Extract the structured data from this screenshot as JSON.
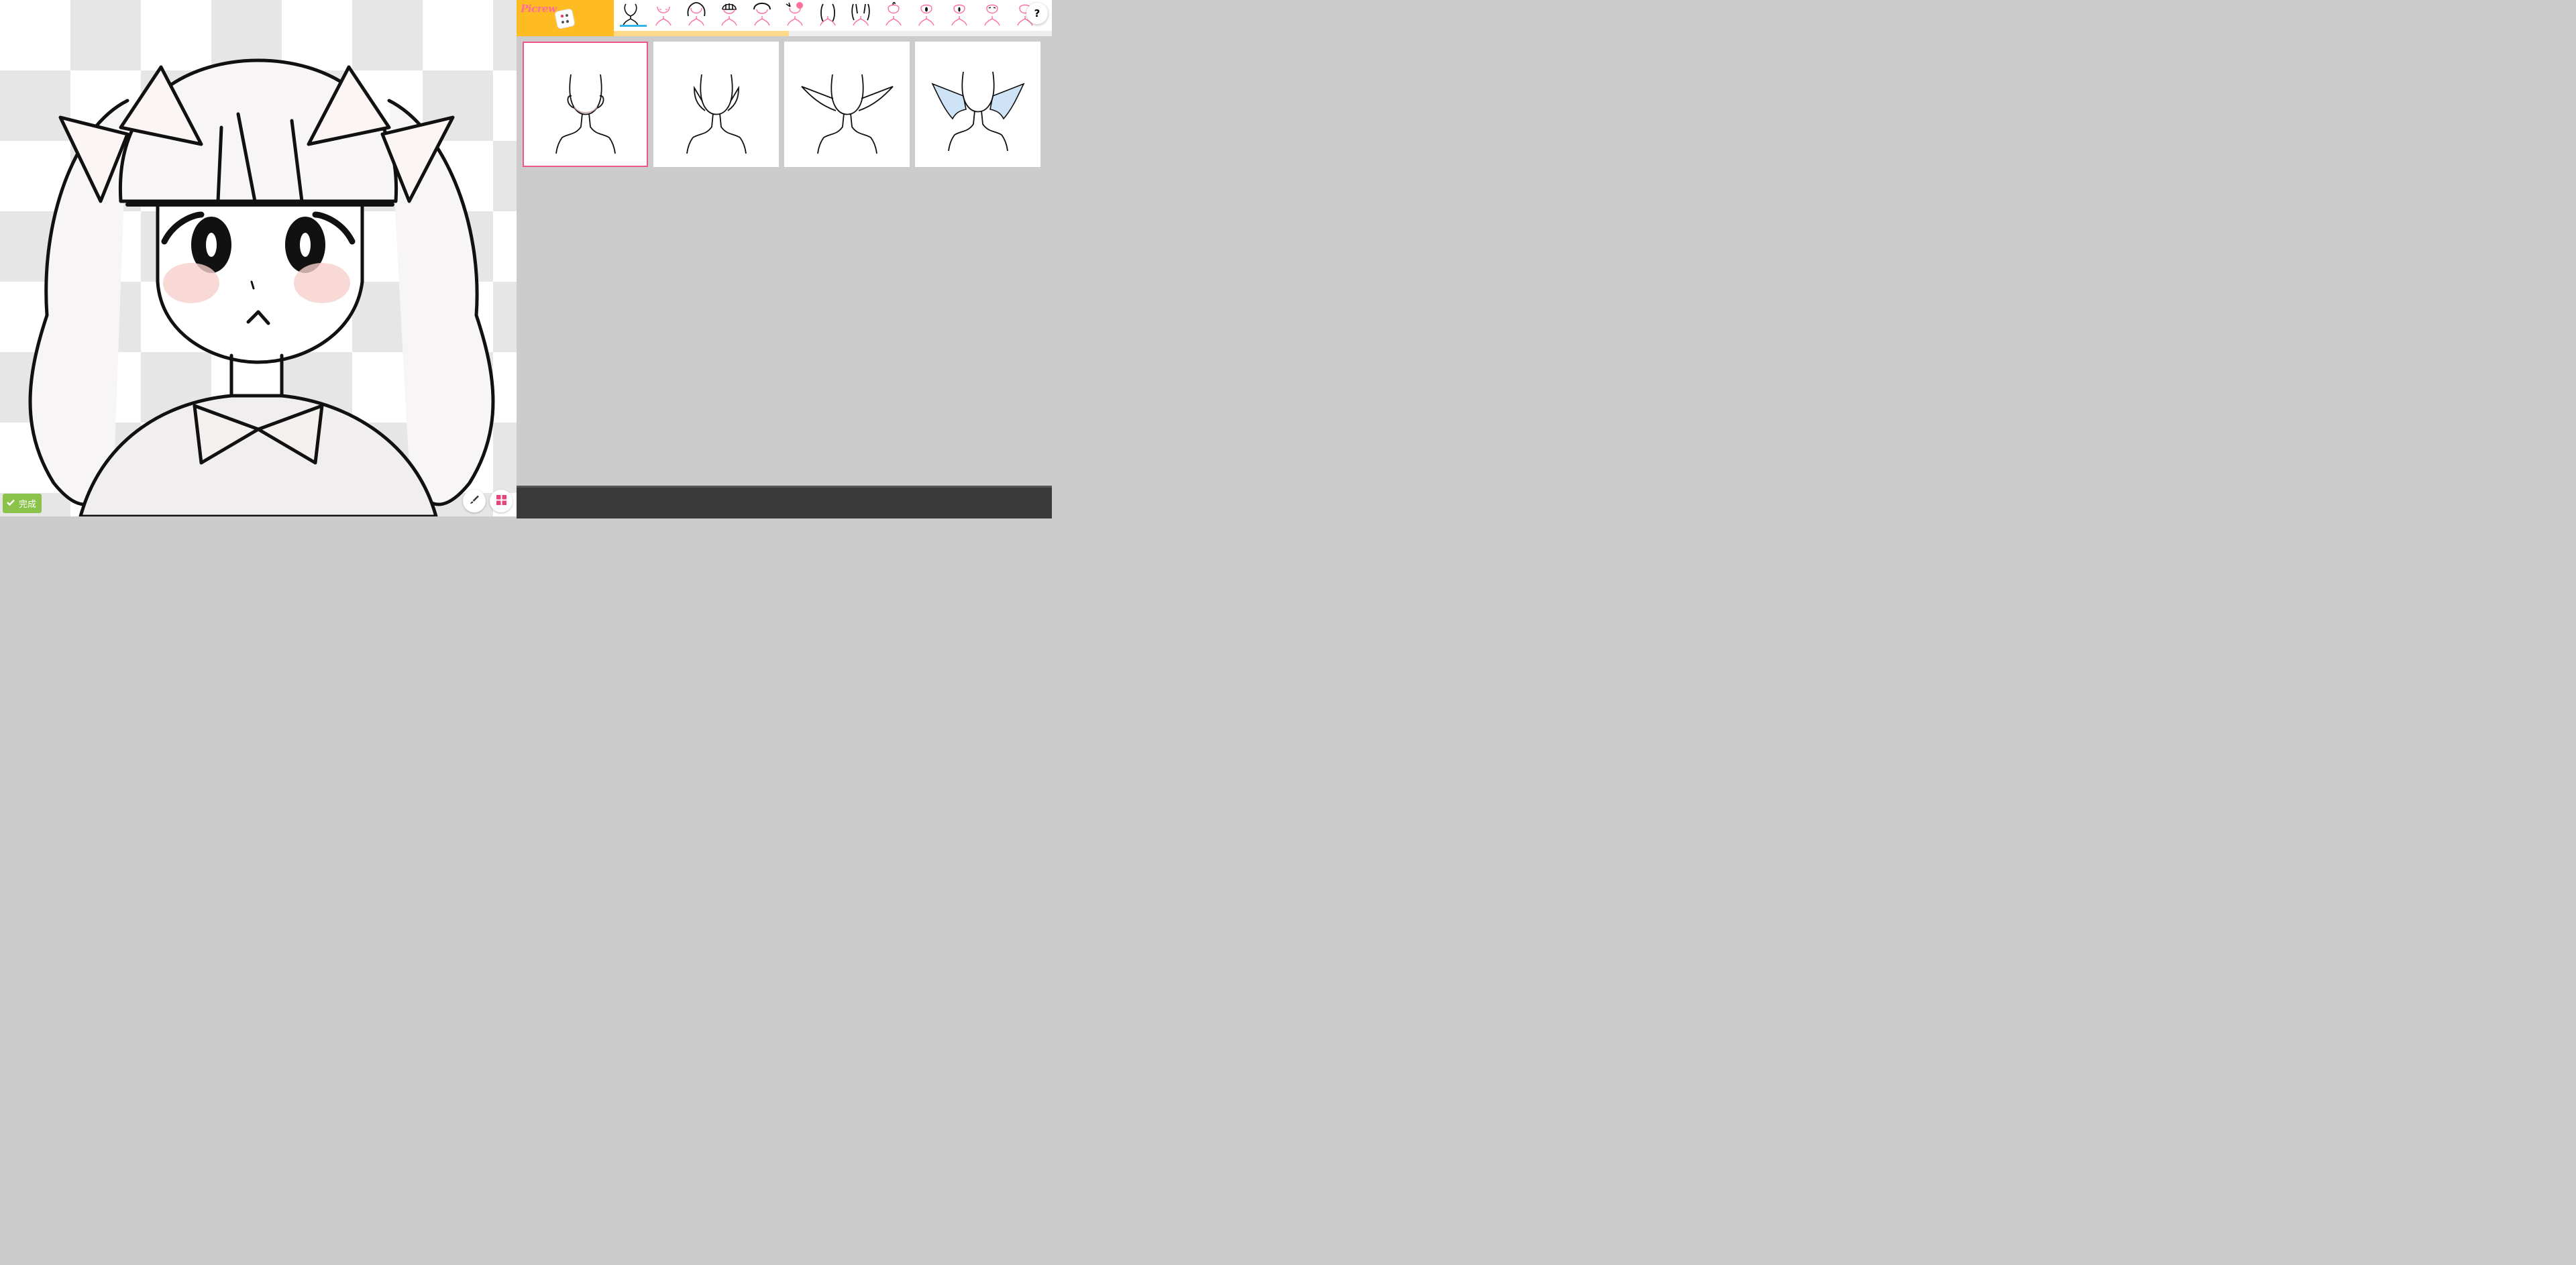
{
  "app": {
    "logo_text": "Picrew"
  },
  "toolbar": {
    "done_label": "完成",
    "done_icon": "check-icon",
    "brush_icon": "paintbrush-icon",
    "grid_icon": "grid-icon",
    "help_label": "?"
  },
  "tabs": [
    {
      "name": "tab-face-shape",
      "icon": "face-outline-icon",
      "active": true
    },
    {
      "name": "tab-face-blush",
      "icon": "blush-icon"
    },
    {
      "name": "tab-hair-back",
      "icon": "hair-back-icon"
    },
    {
      "name": "tab-hair-front",
      "icon": "bangs-icon"
    },
    {
      "name": "tab-hair-accessory",
      "icon": "headband-icon"
    },
    {
      "name": "tab-hair-side",
      "icon": "side-ribbon-icon"
    },
    {
      "name": "tab-sidelocks",
      "icon": "sidelocks-icon"
    },
    {
      "name": "tab-twintails",
      "icon": "twintails-icon"
    },
    {
      "name": "tab-ahoge",
      "icon": "ahoge-icon"
    },
    {
      "name": "tab-eyes",
      "icon": "eyes-icon"
    },
    {
      "name": "tab-eye-highlight",
      "icon": "eye-highlight-icon"
    },
    {
      "name": "tab-eyebrows",
      "icon": "eyebrows-icon"
    },
    {
      "name": "tab-extra",
      "icon": "extra-icon"
    }
  ],
  "progress": {
    "fraction": 0.4
  },
  "options": [
    {
      "name": "ear-human",
      "selected": true
    },
    {
      "name": "ear-elf-short"
    },
    {
      "name": "ear-elf-long"
    },
    {
      "name": "ear-bat-wings"
    }
  ],
  "colors": {
    "accent_yellow": "#ffbb22",
    "selected_border": "#ee5588",
    "active_tab_underline": "#33b5e5",
    "done_green": "#8bc34a",
    "icon_pink": "#ff6f9a"
  }
}
